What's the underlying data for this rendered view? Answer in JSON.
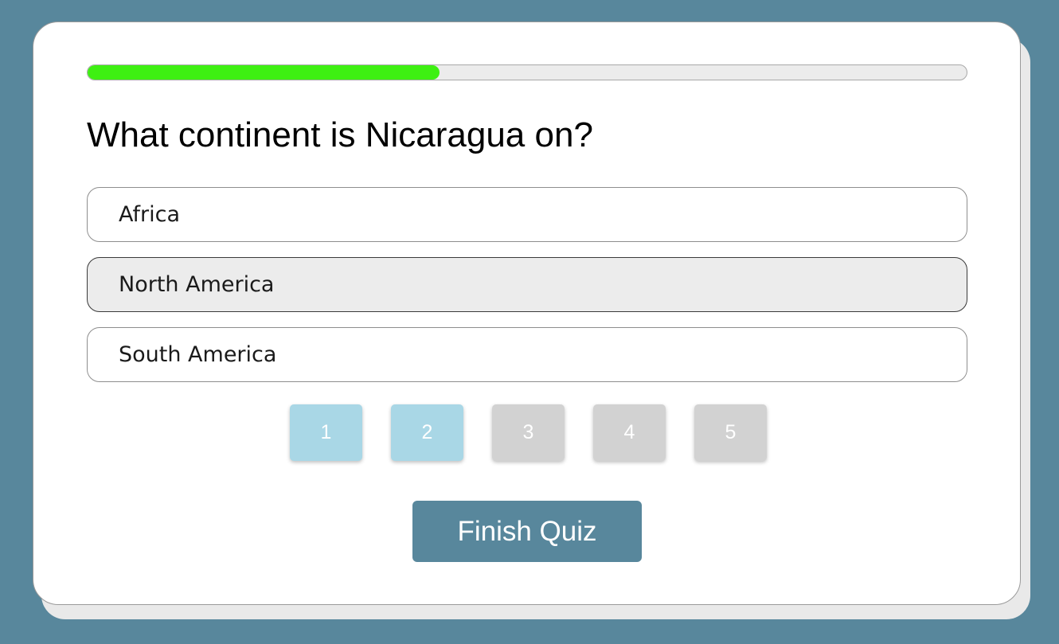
{
  "quiz": {
    "progress": 0.4,
    "question": "What continent is Nicaragua on?",
    "options": [
      {
        "label": "Africa",
        "selected": false
      },
      {
        "label": "North America",
        "selected": true
      },
      {
        "label": "South America",
        "selected": false
      }
    ],
    "pages": [
      {
        "label": "1",
        "visited": true
      },
      {
        "label": "2",
        "visited": true
      },
      {
        "label": "3",
        "visited": false
      },
      {
        "label": "4",
        "visited": false
      },
      {
        "label": "5",
        "visited": false
      }
    ],
    "finish_label": "Finish Quiz"
  },
  "colors": {
    "background": "#58879c",
    "progress_fill": "#3ef012",
    "page_visited": "#a9d7e6",
    "page_unvisited": "#d2d2d2",
    "option_selected": "#ececec",
    "finish_button": "#58879c"
  }
}
